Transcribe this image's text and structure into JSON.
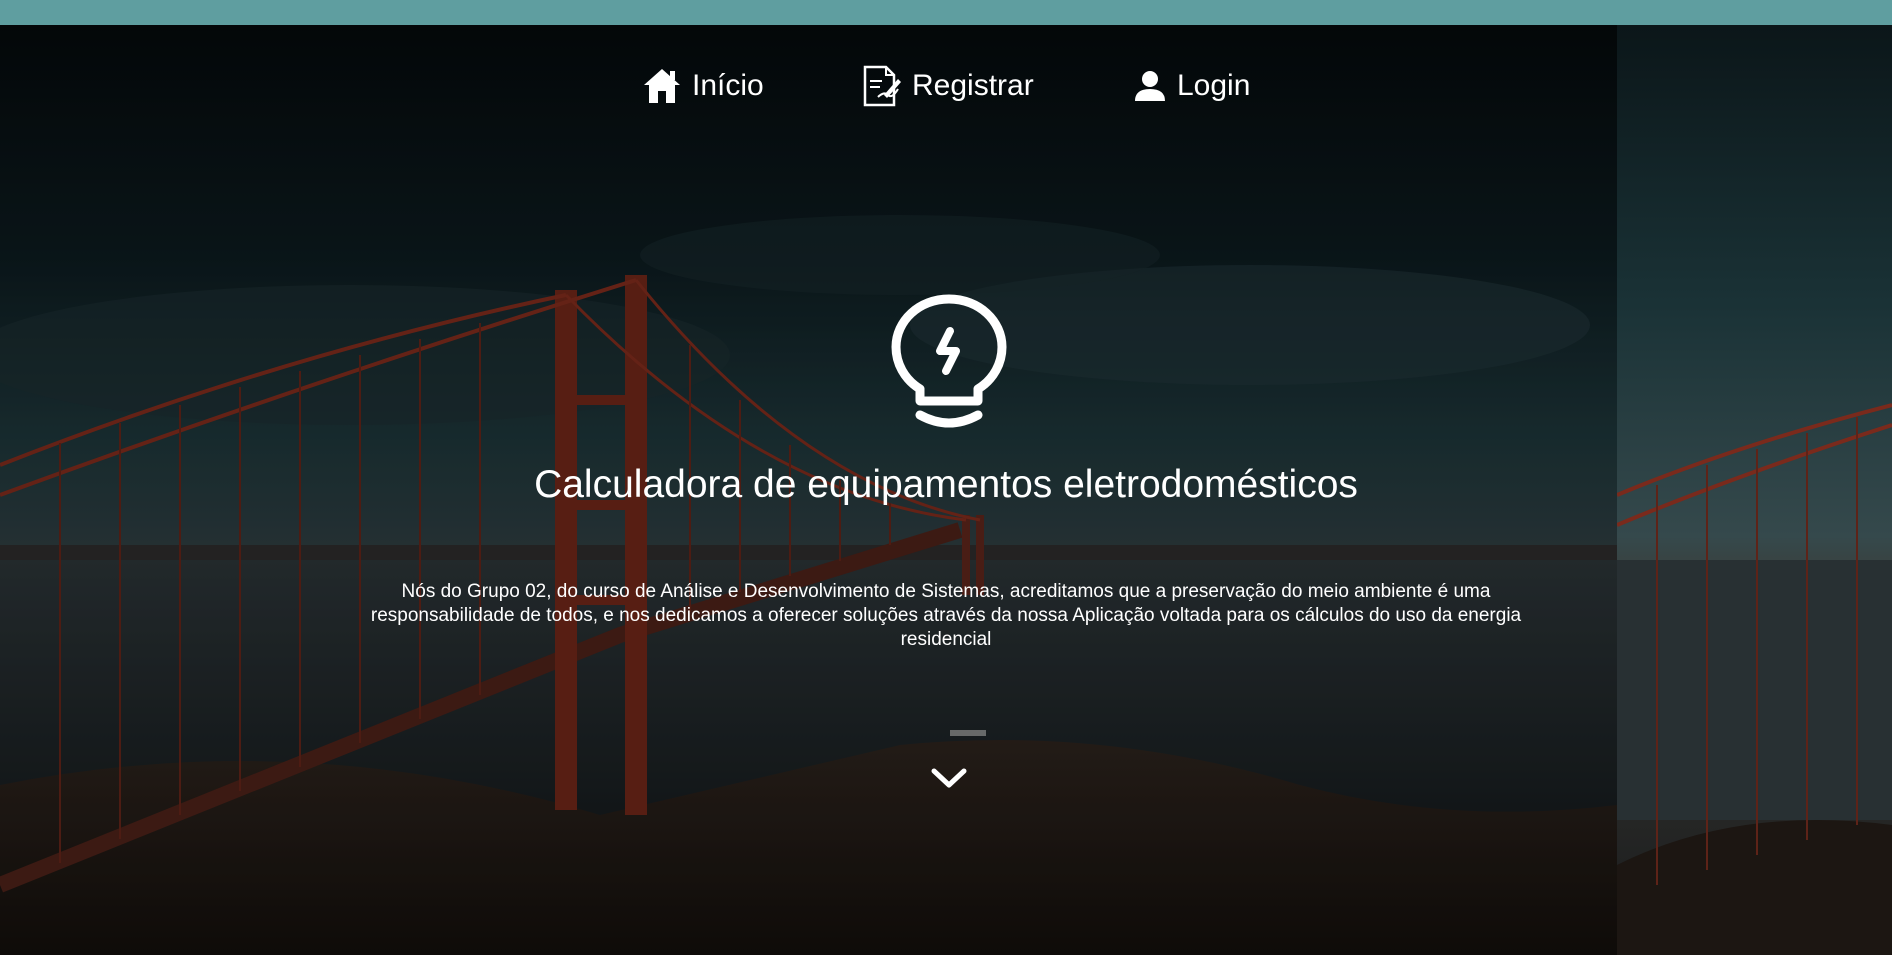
{
  "nav": {
    "home": {
      "label": "Início",
      "icon": "home-icon"
    },
    "register": {
      "label": "Registrar",
      "icon": "register-document-icon"
    },
    "login": {
      "label": "Login",
      "icon": "user-icon"
    }
  },
  "hero": {
    "icon": "lightbulb-bolt-icon",
    "title": "Calculadora de equipamentos eletrodomésticos",
    "description": "Nós do Grupo 02, do curso de Análise e Desenvolvimento de Sistemas, acreditamos que a preservação do meio ambiente é uma responsabilidade de todos, e nos dedicamos a oferecer soluções através da nossa Aplicação voltada para os cálculos do uso da energia residencial",
    "scroll_icon": "chevron-down-icon"
  },
  "colors": {
    "topbar": "#5f9ea0",
    "text": "#ffffff",
    "bridge": "#7a2a1c"
  }
}
